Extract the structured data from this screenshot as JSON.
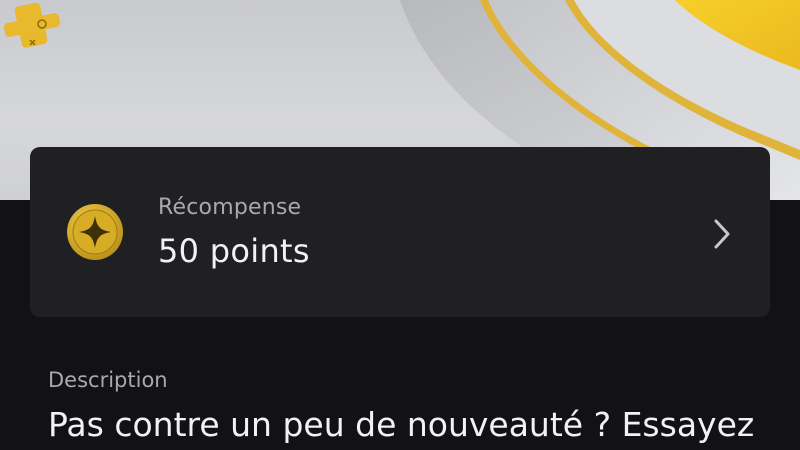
{
  "reward": {
    "label": "Récompense",
    "value": "50 points"
  },
  "description": {
    "label": "Description",
    "text": "Pas contre un peu de nouveauté ? Essayez"
  },
  "icons": {
    "logo": "playstation-plus-icon",
    "coin": "reward-coin-icon",
    "chevron": "chevron-right-icon"
  },
  "colors": {
    "accent_gold": "#e6b82e",
    "background": "#121214",
    "card": "#202023"
  }
}
